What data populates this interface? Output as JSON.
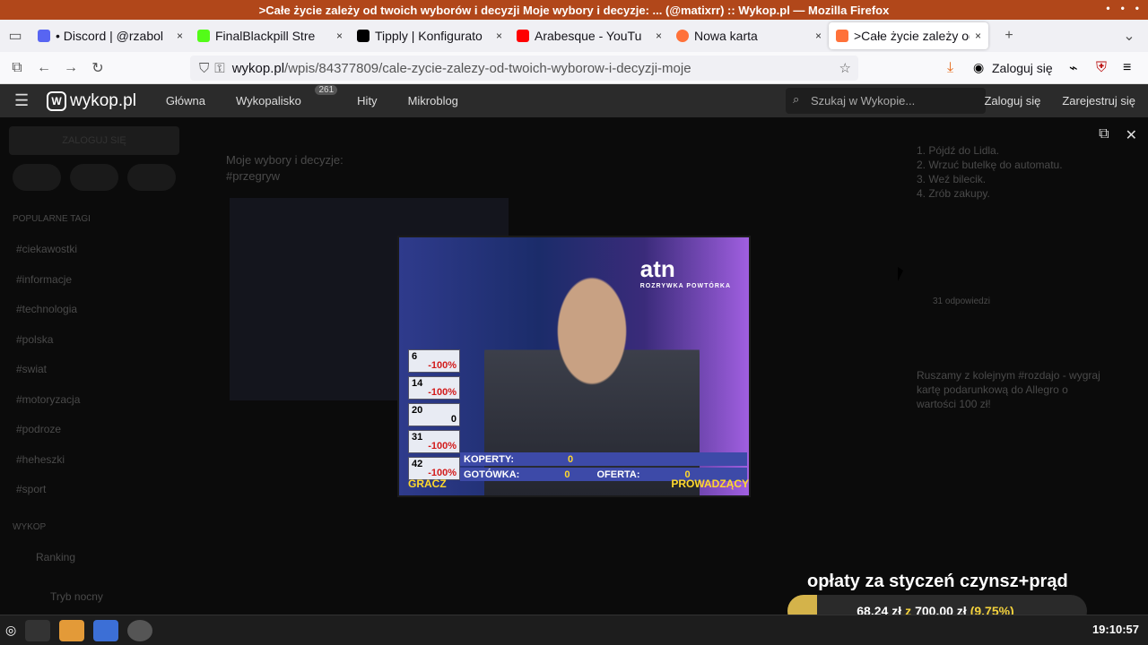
{
  "window": {
    "title": ">Całe życie zależy od twoich wyborów i decyzji Moje wybory i decyzje: ... (@matixrr) :: Wykop.pl — Mozilla Firefox",
    "controls": [
      "•",
      "•",
      "•"
    ]
  },
  "tabs": [
    {
      "label": "• Discord | @rzabol",
      "color": "#5865F2"
    },
    {
      "label": "FinalBlackpill Stre",
      "color": "#53fc18"
    },
    {
      "label": "Tipply | Konfigurato",
      "color": "#000000"
    },
    {
      "label": "Arabesque - YouTu",
      "color": "#ff0000"
    },
    {
      "label": "Nowa karta",
      "color": "#ff7139"
    },
    {
      "label": ">Całe życie zależy od",
      "color": "#ff7139",
      "active": true
    }
  ],
  "navbar": {
    "url_host": "wykop.pl",
    "url_path": "/wpis/84377809/cale-zycie-zalezy-od-twoich-wyborow-i-decyzji-moje",
    "login_label": "Zaloguj się"
  },
  "wykop": {
    "logo": "wykop.pl",
    "nav": [
      "Główna",
      "Wykopalisko",
      "Hity",
      "Mikroblog"
    ],
    "wykopalisko_badge": "261",
    "search_placeholder": "Szukaj w Wykopie...",
    "login": "Zaloguj się",
    "register": "Zarejestruj się"
  },
  "background": {
    "post_title": "Moje wybory i decyzje:",
    "post_tag": "#przegryw",
    "sidebar_login": "ZALOGUJ SIĘ",
    "popular_tags_header": "POPULARNE TAGI",
    "tags": [
      "#ciekawostki",
      "#informacje",
      "#technologia",
      "#polska",
      "#swiat",
      "#motoryzacja",
      "#podroze",
      "#heheszki",
      "#sport"
    ],
    "wykop_header": "WYKOP",
    "ranking": "Ranking",
    "dark_mode": "Tryb nocny",
    "right_lines": [
      "1. Pójdź do Lidla.",
      "2. Wrzuć butelkę do automatu.",
      "3. Weź bilecik.",
      "4. Zrób zakupy."
    ],
    "replies": "31 odpowiedzi",
    "ad_text": "Ruszamy z kolejnym #rozdajo - wygraj kartę podarunkową do Allegro o wartości 100 zł!"
  },
  "overlay": {
    "scores": [
      {
        "n": "6",
        "v": "-100%"
      },
      {
        "n": "14",
        "v": "-100%"
      },
      {
        "n": "20",
        "v": "0"
      },
      {
        "n": "31",
        "v": "-100%"
      },
      {
        "n": "42",
        "v": "-100%"
      }
    ],
    "koperty_label": "KOPERTY:",
    "koperty_value": "0",
    "gotowka_label": "GOTÓWKA:",
    "gotowka_value": "0",
    "oferta_label": "OFERTA:",
    "oferta_value": "0",
    "gracz": "GRACZ",
    "prowadzacy": "PROWADZĄCY",
    "logo": "atn",
    "logo_sub": "ROZRYWKA POWTÓRKA"
  },
  "stream_goal": {
    "title": "opłaty za styczeń czynsz+prąd",
    "current": "68,24 zł",
    "separator": "z",
    "goal": "700,00 zł",
    "percent": "(9.75%)",
    "progress": 0.0975
  },
  "taskbar": {
    "clock": "19:10:57"
  }
}
